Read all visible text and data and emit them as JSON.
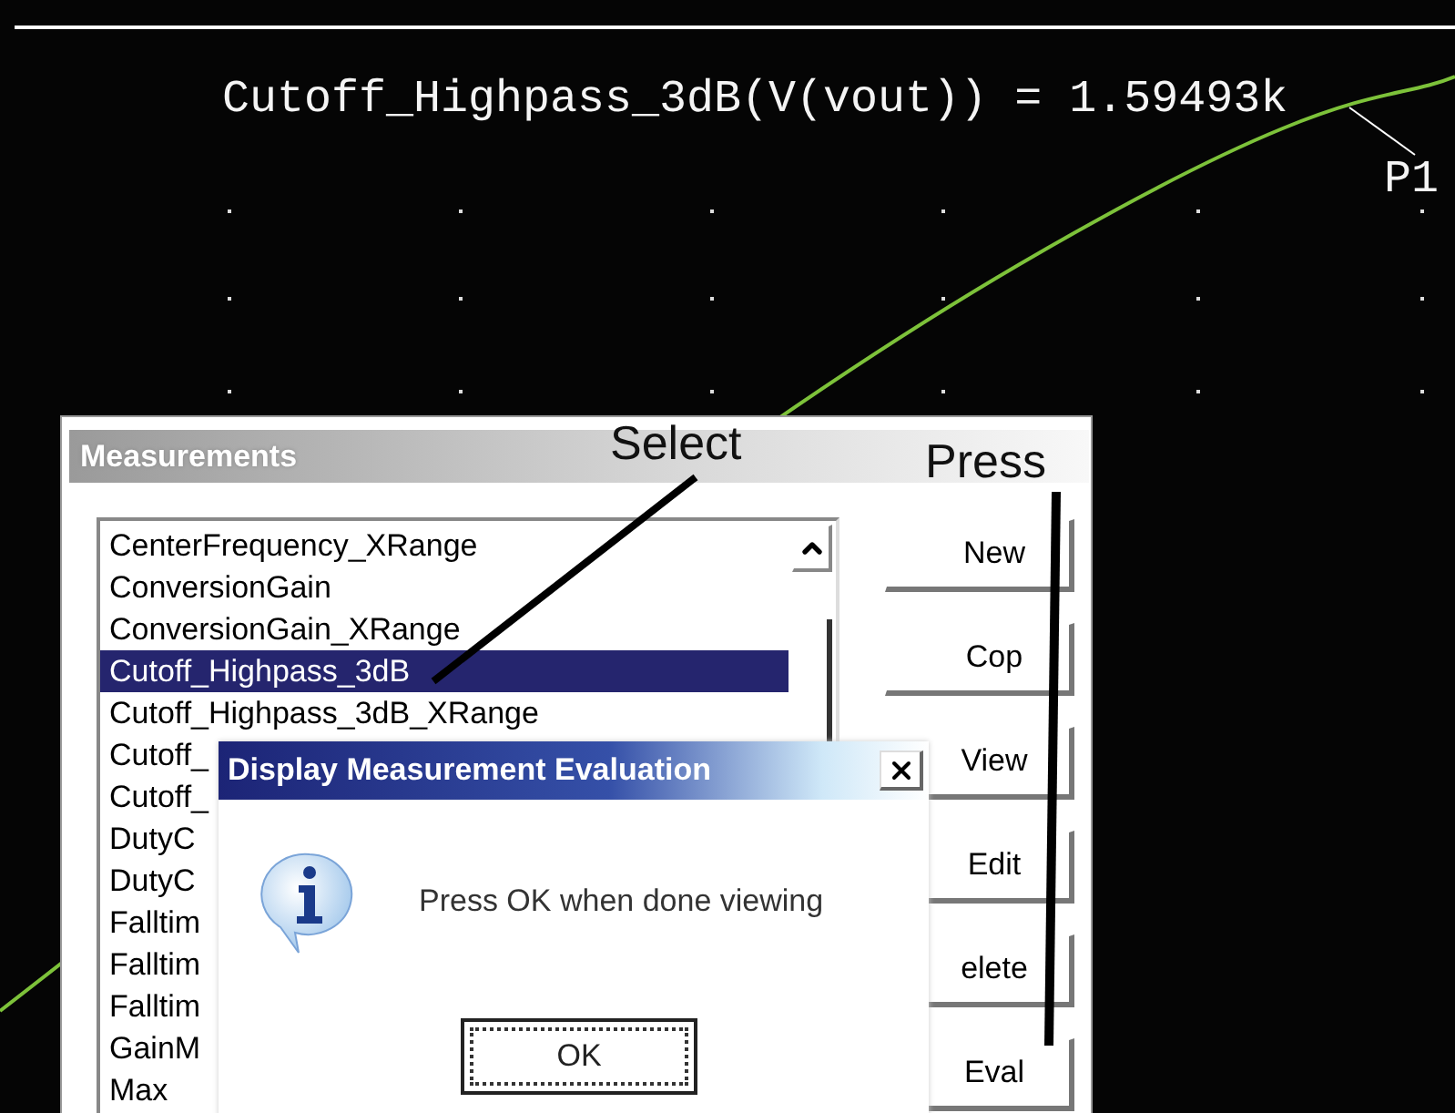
{
  "plot": {
    "readout": "Cutoff_Highpass_3dB(V(vout)) = 1.59493k",
    "marker": "P1"
  },
  "measurements_window": {
    "title": "Measurements",
    "items": [
      {
        "label": "CenterFrequency_XRange",
        "selected": false
      },
      {
        "label": "ConversionGain",
        "selected": false
      },
      {
        "label": "ConversionGain_XRange",
        "selected": false
      },
      {
        "label": "Cutoff_Highpass_3dB",
        "selected": true
      },
      {
        "label": "Cutoff_Highpass_3dB_XRange",
        "selected": false
      },
      {
        "label": "Cutoff_",
        "selected": false
      },
      {
        "label": "Cutoff_",
        "selected": false
      },
      {
        "label": "DutyC",
        "selected": false
      },
      {
        "label": "DutyC",
        "selected": false
      },
      {
        "label": "Falltim",
        "selected": false
      },
      {
        "label": "Falltim",
        "selected": false
      },
      {
        "label": "Falltim",
        "selected": false
      },
      {
        "label": "GainM",
        "selected": false
      },
      {
        "label": "Max",
        "selected": false
      }
    ],
    "buttons": [
      "New",
      "Cop",
      "View",
      "Edit",
      "elete",
      "Eval"
    ]
  },
  "annotations": {
    "select": "Select",
    "press": "Press"
  },
  "dialog": {
    "title": "Display Measurement Evaluation",
    "message": "Press OK when done viewing",
    "ok_button": "OK"
  }
}
